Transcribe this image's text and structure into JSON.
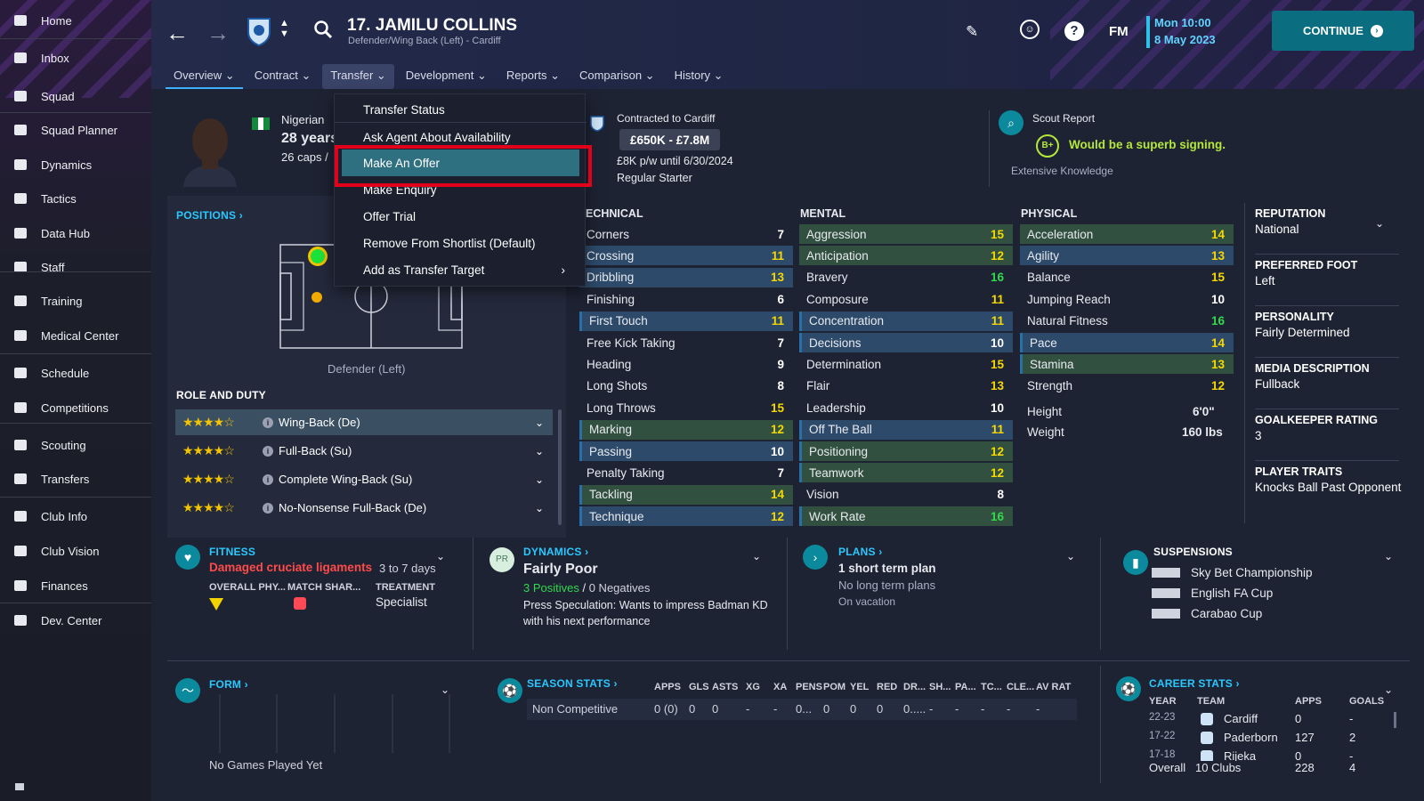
{
  "sidebar": {
    "items": [
      {
        "label": "Home",
        "icon": "home-icon"
      },
      {
        "label": "Inbox",
        "icon": "inbox-icon"
      },
      {
        "label": "Squad",
        "icon": "squad-icon"
      },
      {
        "label": "Squad Planner",
        "icon": "clipboard-icon"
      },
      {
        "label": "Dynamics",
        "icon": "dynamics-icon"
      },
      {
        "label": "Tactics",
        "icon": "tactics-icon"
      },
      {
        "label": "Data Hub",
        "icon": "data-hub-icon"
      },
      {
        "label": "Staff",
        "icon": "staff-icon"
      },
      {
        "label": "Training",
        "icon": "training-icon"
      },
      {
        "label": "Medical Center",
        "icon": "medical-icon"
      },
      {
        "label": "Schedule",
        "icon": "calendar-icon"
      },
      {
        "label": "Competitions",
        "icon": "trophy-icon"
      },
      {
        "label": "Scouting",
        "icon": "search-icon"
      },
      {
        "label": "Transfers",
        "icon": "transfers-icon"
      },
      {
        "label": "Club Info",
        "icon": "shield-icon"
      },
      {
        "label": "Club Vision",
        "icon": "vision-icon"
      },
      {
        "label": "Finances",
        "icon": "finances-icon"
      },
      {
        "label": "Dev. Center",
        "icon": "dev-center-icon"
      }
    ]
  },
  "header": {
    "player_name": "17. JAMILU COLLINS",
    "player_sub": "Defender/Wing Back (Left) - Cardiff",
    "fm_label": "FM",
    "date_time": "Mon 10:00",
    "date": "8 May 2023",
    "continue_label": "CONTINUE"
  },
  "tabs": [
    "Overview",
    "Contract",
    "Transfer",
    "Development",
    "Reports",
    "Comparison",
    "History"
  ],
  "transfer_menu": {
    "items": [
      "Transfer Status",
      "Ask Agent About Availability",
      "Make An Offer",
      "Make Enquiry",
      "Offer Trial",
      "Remove From Shortlist (Default)",
      "Add as Transfer Target"
    ],
    "selected": "Make An Offer"
  },
  "profile": {
    "nationality": "Nigerian",
    "age": "28 years",
    "caps": "26 caps /"
  },
  "contract": {
    "title": "Contracted to Cardiff",
    "value": "£650K - £7.8M",
    "wage": "£8K p/w until 6/30/2024",
    "status": "Regular Starter"
  },
  "scout": {
    "title": "Scout Report",
    "grade": "B+",
    "verdict": "Would be a superb signing.",
    "knowledge": "Extensive Knowledge"
  },
  "positions": {
    "title": "POSITIONS",
    "position_label": "Defender (Left)"
  },
  "role_duty": {
    "title": "ROLE AND DUTY",
    "roles": [
      {
        "name": "Wing-Back (De)",
        "stars": "★★★★☆"
      },
      {
        "name": "Full-Back (Su)",
        "stars": "★★★★☆"
      },
      {
        "name": "Complete Wing-Back (Su)",
        "stars": "★★★★☆"
      },
      {
        "name": "No-Nonsense Full-Back (De)",
        "stars": "★★★★☆"
      }
    ]
  },
  "attributes": {
    "technical_title": "ECHNICAL",
    "mental_title": "MENTAL",
    "physical_title": "PHYSICAL",
    "technical": [
      [
        "Corners",
        "7"
      ],
      [
        "Crossing",
        "11"
      ],
      [
        "Dribbling",
        "13"
      ],
      [
        "Finishing",
        "6"
      ],
      [
        "First Touch",
        "11"
      ],
      [
        "Free Kick Taking",
        "7"
      ],
      [
        "Heading",
        "9"
      ],
      [
        "Long Shots",
        "8"
      ],
      [
        "Long Throws",
        "15"
      ],
      [
        "Marking",
        "12"
      ],
      [
        "Passing",
        "10"
      ],
      [
        "Penalty Taking",
        "7"
      ],
      [
        "Tackling",
        "14"
      ],
      [
        "Technique",
        "12"
      ]
    ],
    "mental": [
      [
        "Aggression",
        "15"
      ],
      [
        "Anticipation",
        "12"
      ],
      [
        "Bravery",
        "16"
      ],
      [
        "Composure",
        "11"
      ],
      [
        "Concentration",
        "11"
      ],
      [
        "Decisions",
        "10"
      ],
      [
        "Determination",
        "15"
      ],
      [
        "Flair",
        "13"
      ],
      [
        "Leadership",
        "10"
      ],
      [
        "Off The Ball",
        "11"
      ],
      [
        "Positioning",
        "12"
      ],
      [
        "Teamwork",
        "12"
      ],
      [
        "Vision",
        "8"
      ],
      [
        "Work Rate",
        "16"
      ]
    ],
    "physical": [
      [
        "Acceleration",
        "14"
      ],
      [
        "Agility",
        "13"
      ],
      [
        "Balance",
        "15"
      ],
      [
        "Jumping Reach",
        "10"
      ],
      [
        "Natural Fitness",
        "16"
      ],
      [
        "Pace",
        "14"
      ],
      [
        "Stamina",
        "13"
      ],
      [
        "Strength",
        "12"
      ]
    ],
    "height_label": "Height",
    "height": "6'0\"",
    "weight_label": "Weight",
    "weight": "160 lbs"
  },
  "side_info": [
    {
      "label": "REPUTATION",
      "value": "National"
    },
    {
      "label": "PREFERRED FOOT",
      "value": "Left"
    },
    {
      "label": "PERSONALITY",
      "value": "Fairly Determined"
    },
    {
      "label": "MEDIA DESCRIPTION",
      "value": "Fullback"
    },
    {
      "label": "GOALKEEPER RATING",
      "value": "3"
    },
    {
      "label": "PLAYER TRAITS",
      "value": "Knocks Ball Past Opponent"
    }
  ],
  "fitness": {
    "title": "FITNESS",
    "injury": "Damaged cruciate ligaments",
    "duration": "3 to 7 days",
    "col1": "OVERALL PHY...",
    "col2": "MATCH SHAR...",
    "col3": "TREATMENT",
    "treatment": "Specialist"
  },
  "dynamics": {
    "title": "DYNAMICS",
    "badge": "PR",
    "status": "Fairly Poor",
    "positives": "3 Positives",
    "negatives": "0 Negatives",
    "note": "Press Speculation: Wants to impress Badman KD with his next performance"
  },
  "plans": {
    "title": "PLANS",
    "short": "1 short term plan",
    "long": "No long term plans",
    "vacation": "On vacation"
  },
  "suspensions": {
    "title": "SUSPENSIONS",
    "items": [
      "Sky Bet Championship",
      "English FA Cup",
      "Carabao Cup"
    ]
  },
  "form": {
    "title": "FORM",
    "empty": "No Games Played Yet"
  },
  "season_stats": {
    "title": "SEASON STATS",
    "headers": [
      "APPS",
      "GLS",
      "ASTS",
      "XG",
      "XA",
      "PENS",
      "POM",
      "YEL",
      "RED",
      "DR...",
      "SH...",
      "PA...",
      "TC...",
      "CLE...",
      "AV RAT"
    ],
    "row_label": "Non Competitive",
    "values": [
      "0 (0)",
      "0",
      "0",
      "-",
      "-",
      "0...",
      "0",
      "0",
      "0",
      "0.....",
      "-",
      "-",
      "-",
      "-",
      "-"
    ]
  },
  "career_stats": {
    "title": "CAREER STATS",
    "headers": [
      "YEAR",
      "TEAM",
      "APPS",
      "GOALS"
    ],
    "rows": [
      {
        "year": "22-23",
        "team": "Cardiff",
        "apps": "0",
        "goals": "-"
      },
      {
        "year": "17-22",
        "team": "Paderborn",
        "apps": "127",
        "goals": "2"
      },
      {
        "year": "17-18",
        "team": "Rijeka",
        "apps": "0",
        "goals": "-"
      }
    ],
    "overall_label": "Overall",
    "overall_clubs": "10 Clubs",
    "overall_apps": "228",
    "overall_goals": "4"
  }
}
